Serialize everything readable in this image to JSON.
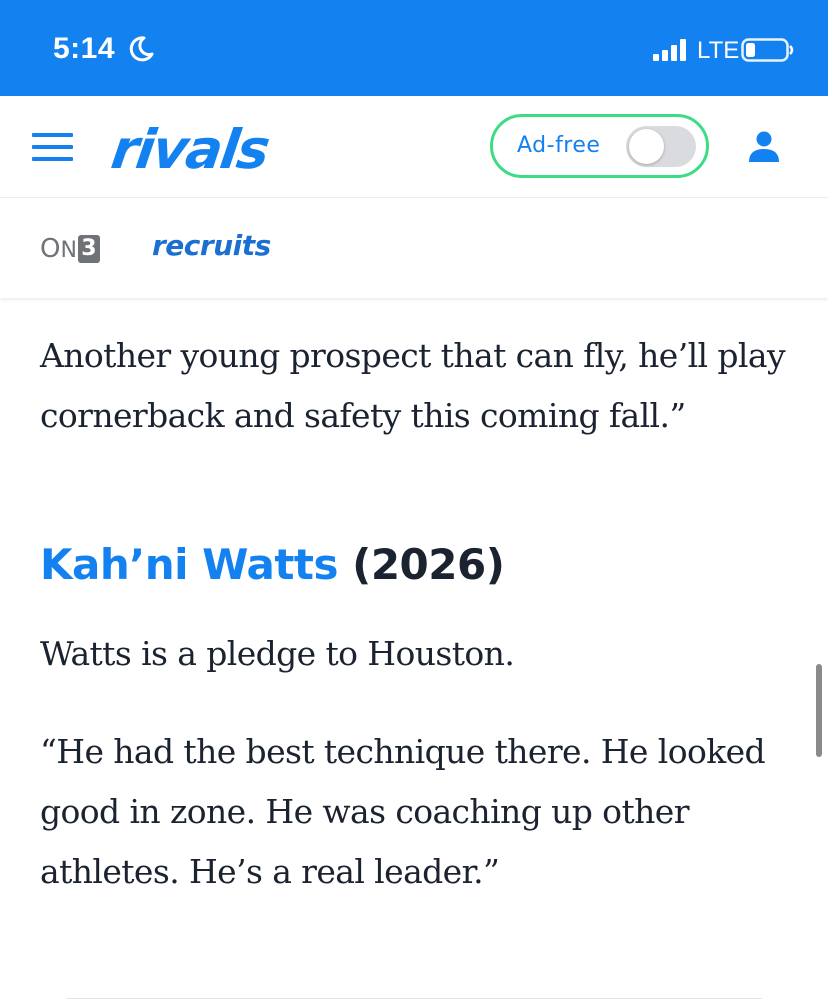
{
  "status_bar": {
    "time": "5:14",
    "network": "LTE",
    "icons": [
      "moon-icon",
      "signal-icon",
      "battery-icon"
    ]
  },
  "header": {
    "logo": "rivals",
    "adfree_label": "Ad-free",
    "adfree_enabled": false,
    "icons": [
      "menu-icon",
      "user-icon"
    ],
    "colors": {
      "brand": "#1481f0",
      "adfree_border": "#3ddc84"
    }
  },
  "subnav": {
    "partner_logo": "ON3",
    "section_link": "recruits"
  },
  "article": {
    "intro_paragraph": "Another young prospect that can fly, he’ll play cornerback and safety this coming fall.”",
    "player_heading": {
      "name": "Kah’ni Watts",
      "year": "(2026)"
    },
    "pledge_paragraph": "Watts is a pledge to Houston.",
    "quote_paragraph": "“He had the best technique there. He looked good in zone. He was coaching up other athletes. He’s a real leader.”"
  }
}
